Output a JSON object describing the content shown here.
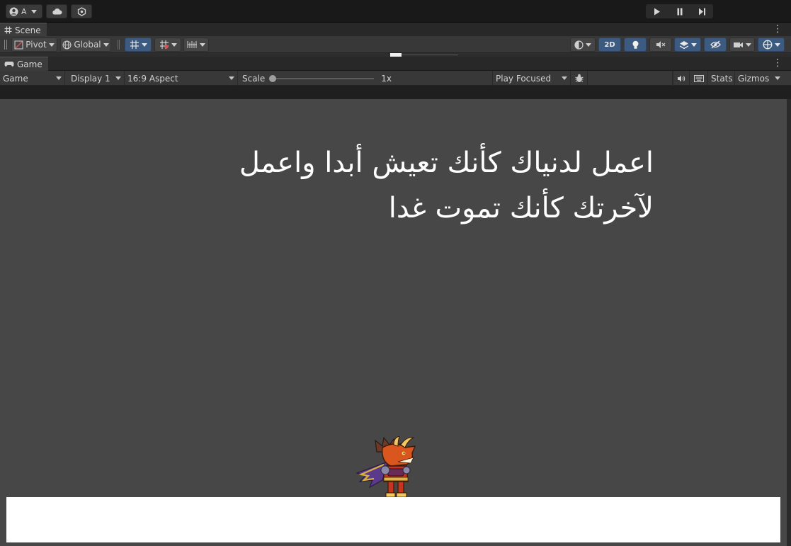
{
  "top_bar": {
    "account_label": "A",
    "cloud_icon": "cloud-icon",
    "collab_icon": "services-icon",
    "play_icon": "play-icon",
    "pause_icon": "pause-icon",
    "step_icon": "step-icon"
  },
  "scene_tab": {
    "label": "Scene"
  },
  "scene_toolbar": {
    "pivot_label": "Pivot",
    "global_label": "Global",
    "mode_2d_label": "2D"
  },
  "game_tab": {
    "label": "Game"
  },
  "game_toolbar": {
    "view_select": "Game",
    "display_select": "Display 1",
    "aspect_select": "16:9 Aspect",
    "scale_label": "Scale",
    "scale_value": 0,
    "scale_readout": "1x",
    "play_mode_select": "Play Focused",
    "stats_label": "Stats",
    "gizmos_label": "Gizmos"
  },
  "game_view": {
    "quote_lines": [
      "اعمل لدنياك كأنك تعيش أبدا واعمل",
      "لآخرتك كأنك تموت غدا"
    ],
    "character_icon": "dragon-knight-sprite"
  },
  "colors": {
    "background": "#474747",
    "ground": "#ffffff",
    "accent": "#3d5a80"
  }
}
